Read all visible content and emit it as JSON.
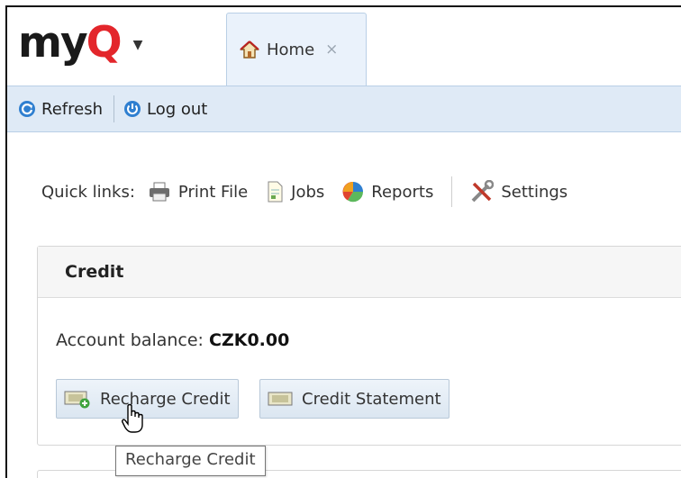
{
  "brand": {
    "logo_prefix": "my",
    "logo_q": "Q",
    "logo_menu_icon": "caret-down-icon",
    "logo_color": "#1a1a1a",
    "accent_color": "#e3262b"
  },
  "tabs": [
    {
      "label": "Home",
      "icon": "home-icon",
      "close_glyph": "×"
    }
  ],
  "toolbar": {
    "refresh_label": "Refresh",
    "logout_label": "Log out"
  },
  "quick_links": {
    "label": "Quick links:",
    "items": [
      {
        "label": "Print File",
        "icon": "printer-icon"
      },
      {
        "label": "Jobs",
        "icon": "document-icon"
      },
      {
        "label": "Reports",
        "icon": "pie-chart-icon"
      },
      {
        "label": "Settings",
        "icon": "tools-icon"
      }
    ]
  },
  "credit": {
    "title": "Credit",
    "balance_label": "Account balance:",
    "balance_value": "CZK0.00",
    "recharge_label": "Recharge Credit",
    "statement_label": "Credit Statement"
  },
  "tooltip": {
    "text": "Recharge Credit"
  },
  "colors": {
    "toolbar_bg": "#dfeaf6",
    "tab_bg": "#eaf2fb",
    "button_bg": "#dbe6f1"
  }
}
